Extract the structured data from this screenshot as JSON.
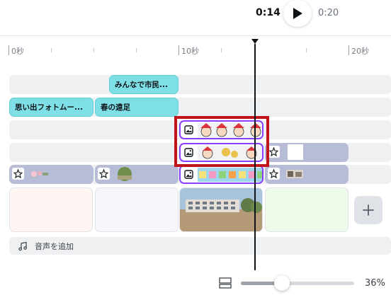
{
  "playback": {
    "current": "0:14",
    "total": "0:20"
  },
  "ruler": {
    "labels": [
      "0秒",
      "10秒",
      "20秒"
    ]
  },
  "tracks": {
    "text1": {
      "label": "みんなで市民..."
    },
    "text2": {
      "labels": [
        "思い出フォトムー...",
        "春の遠足"
      ]
    }
  },
  "audio": {
    "label": "音声を追加"
  },
  "zoom": {
    "percent": "36%",
    "level": 0.36
  },
  "icons": {
    "play": "play-icon",
    "image": "image-icon",
    "element": "shapes-icon",
    "music": "music-note-icon",
    "add": "plus-icon",
    "grid": "grid-view-icon"
  },
  "colors": {
    "text_clip": "#7ee0e6",
    "element_clip": "#b7bdd6",
    "selected": "#8b3dff",
    "highlight": "#c0141b"
  }
}
